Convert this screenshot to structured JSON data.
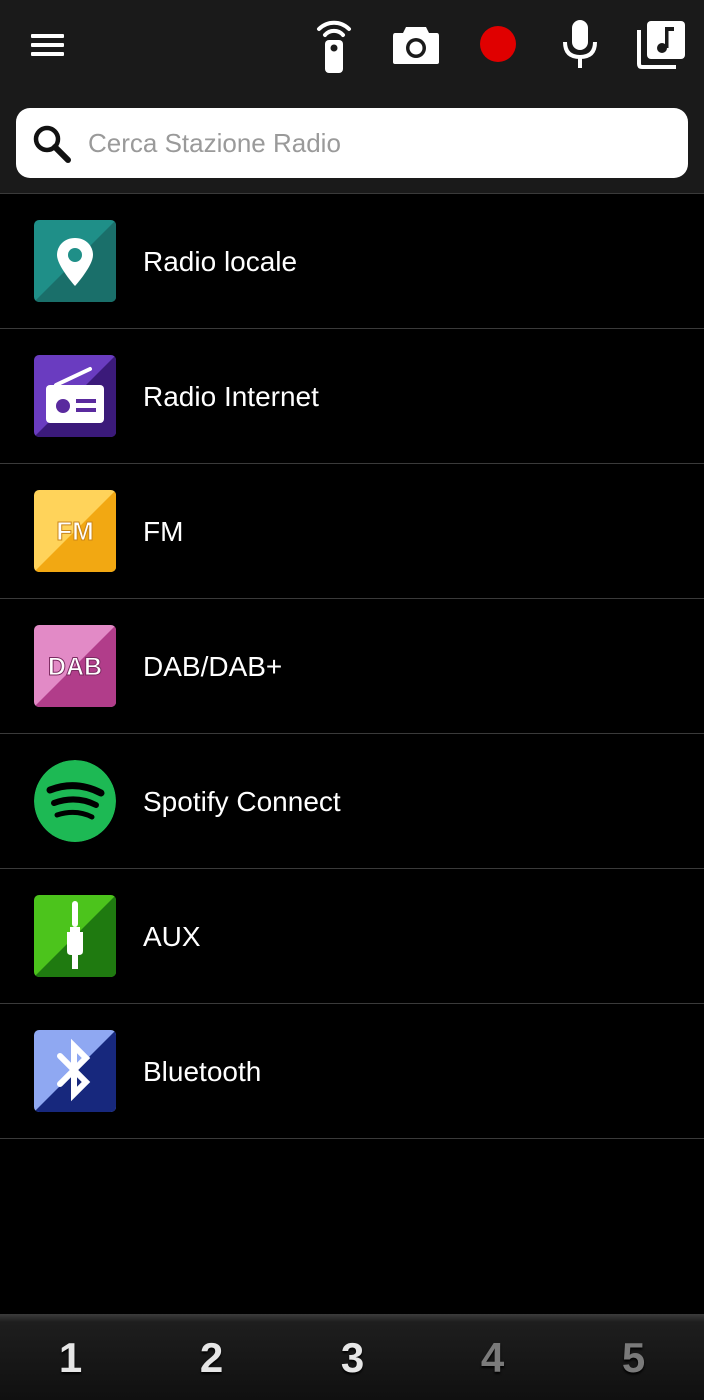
{
  "toolbar": {
    "icons": [
      "menu-icon",
      "remote-control-icon",
      "camera-icon",
      "record-icon",
      "microphone-icon",
      "music-library-icon"
    ],
    "record_color": "#e00000"
  },
  "search": {
    "placeholder": "Cerca Stazione Radio",
    "value": ""
  },
  "sources": [
    {
      "label": "Radio locale",
      "icon": "location-pin-icon",
      "color": "#1f8f88"
    },
    {
      "label": "Radio Internet",
      "icon": "radio-icon",
      "color": "#5a2a9e"
    },
    {
      "label": "FM",
      "icon": "fm-icon",
      "icon_text": "FM",
      "color": "#f4b21c"
    },
    {
      "label": "DAB/DAB+",
      "icon": "dab-icon",
      "icon_text": "DAB",
      "color": "#b8468f"
    },
    {
      "label": "Spotify Connect",
      "icon": "spotify-icon",
      "color": "#1db954"
    },
    {
      "label": "AUX",
      "icon": "aux-jack-icon",
      "color": "#3aa21a"
    },
    {
      "label": "Bluetooth",
      "icon": "bluetooth-icon",
      "color": "#1c2f8f"
    }
  ],
  "presets": [
    "1",
    "2",
    "3",
    "4",
    "5"
  ]
}
